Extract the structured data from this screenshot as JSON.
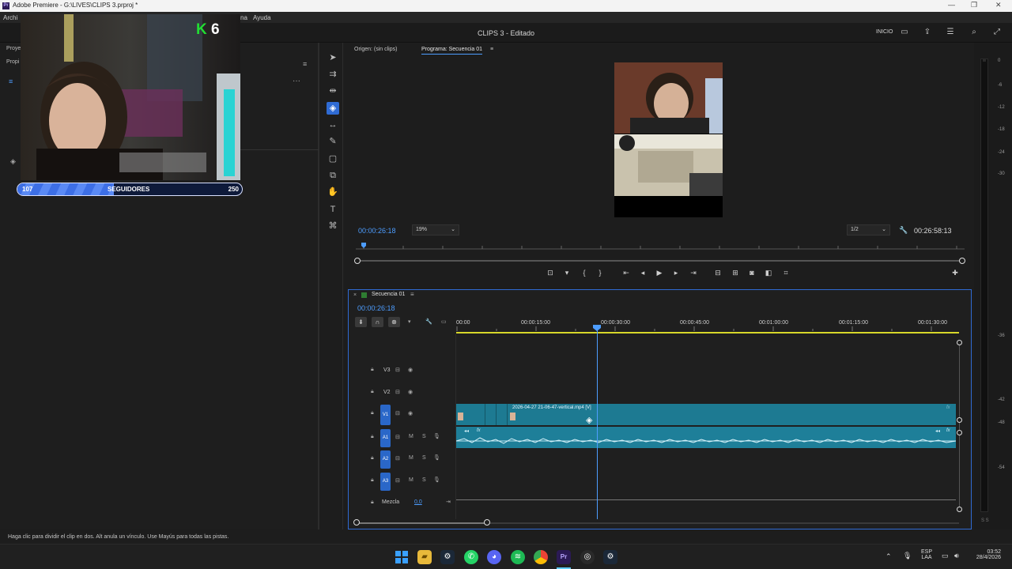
{
  "window": {
    "title": "Adobe Premiere - G:\\LIVES\\CLIPS 3.prproj *",
    "app_badge": "Pr",
    "minimize": "—",
    "maximize": "❐",
    "close": "✕"
  },
  "menu": {
    "left": "Archi",
    "partial": "na",
    "help": "Ayuda"
  },
  "header": {
    "doc_title": "CLIPS 3 - Editado",
    "workspace": "INICIO"
  },
  "left_panel": {
    "tab1": "Proye",
    "tab2": "Propi",
    "more": "···",
    "menu": "≡"
  },
  "overlay": {
    "kills": "6",
    "k_letter": "K",
    "followers_current": "107",
    "followers_label": "SEGUIDORES",
    "followers_goal": "250",
    "progress_fraction": 0.428
  },
  "source_monitor": {
    "label": "Origen: (sin clips)"
  },
  "program_monitor": {
    "label": "Programa: Secuencia 01",
    "timecode": "00:00:26:18",
    "zoom": "19%",
    "resolution": "1/2",
    "duration": "00:26:58:13"
  },
  "timeline": {
    "sequence_name": "Secuencia 01",
    "timecode": "00:00:26:18",
    "ruler": [
      "00:00",
      "00:00:15:00",
      "00:00:30:00",
      "00:00:45:00",
      "00:01:00:00",
      "00:01:15:00",
      "00:01:30:00"
    ],
    "tracks": {
      "v3": "V3",
      "v2": "V2",
      "v1": "V1",
      "a1": "A1",
      "a2": "A2",
      "a3": "A3",
      "mix_label": "Mezcla",
      "mix_value": "0,0",
      "m": "M",
      "s": "S"
    },
    "clip_name": "2026-04-27 21-06-47-vertical.mp4 [V]",
    "fx": "fx"
  },
  "meter": {
    "labels": [
      "0",
      "-6",
      "-12",
      "-18",
      "-24",
      "-30",
      "-36",
      "-42",
      "-48",
      "-54"
    ],
    "bottom": "S S"
  },
  "status": {
    "text": "Haga clic para dividir el clip en dos. Alt anula un vínculo. Use Mayús para todas las pistas."
  },
  "taskbar": {
    "lang_line1": "ESP",
    "lang_line2": "LAA",
    "time": "03:52",
    "date": "28/4/2026"
  },
  "colors": {
    "accent": "#2f6bd4",
    "clip": "#1d7a92",
    "audio": "#1e7f99",
    "playhead": "#4d9dff",
    "ruler_work": "#d7d72a"
  }
}
